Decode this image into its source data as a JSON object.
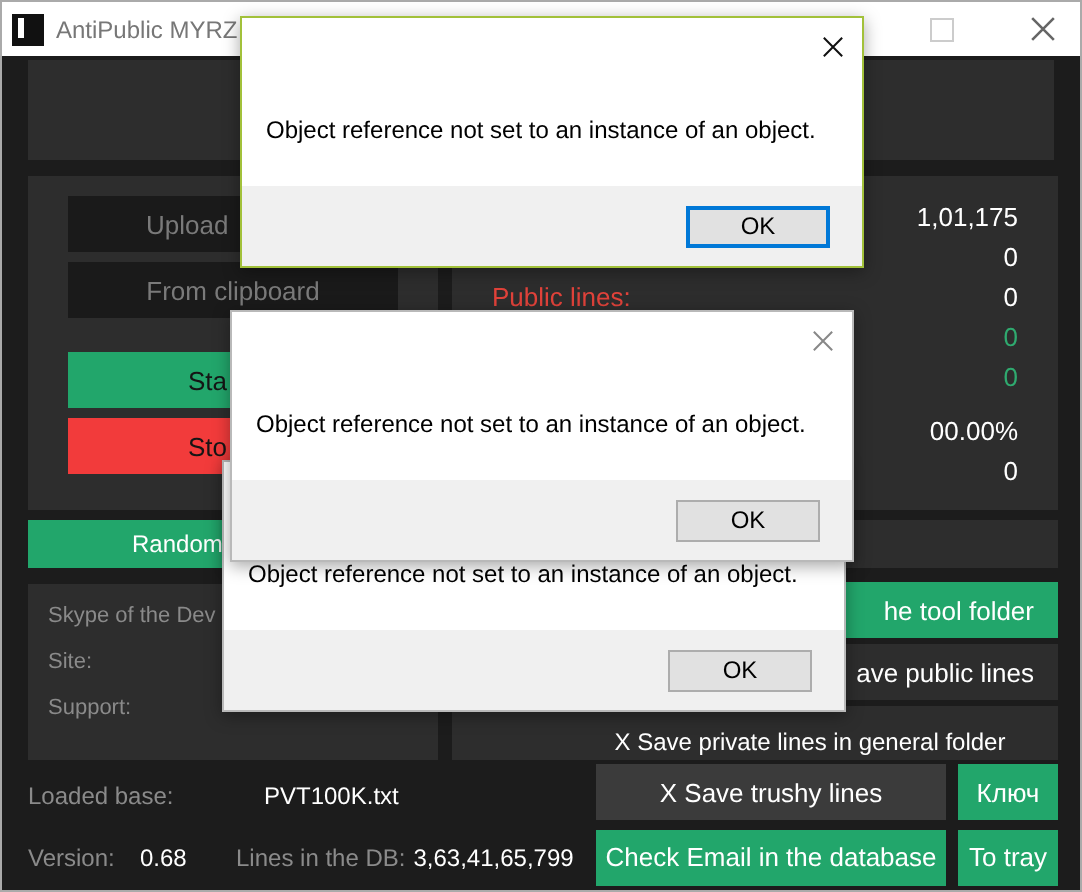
{
  "window": {
    "title": "AntiPublic MYRZ"
  },
  "left_buttons": [
    {
      "label": "Upload",
      "kind": "dark"
    },
    {
      "label": "From clipboard",
      "kind": "dark"
    },
    {
      "label": "Sta",
      "kind": "green"
    },
    {
      "label": "Sto",
      "kind": "red"
    }
  ],
  "stats": [
    {
      "value": "1,01,175",
      "color": "#ffffff"
    },
    {
      "value": "0",
      "color": "#ffffff"
    },
    {
      "label": "Public lines:",
      "value": "0",
      "color": "#ffffff"
    },
    {
      "value": "0",
      "color": "#2faa6f"
    },
    {
      "value": "0",
      "color": "#2faa6f"
    },
    {
      "value": "00.00%",
      "color": "#ffffff"
    },
    {
      "value": "0",
      "color": "#ffffff"
    }
  ],
  "random_button": {
    "label": "Random"
  },
  "info": [
    {
      "label": "Skype of the Dev"
    },
    {
      "label": "Site:"
    },
    {
      "label": "Support:"
    }
  ],
  "right_buttons": [
    {
      "label": "he tool folder",
      "kind": "green"
    },
    {
      "label": "ave public lines",
      "kind": "dark"
    },
    {
      "label": "X Save private lines in general folder",
      "kind": "dark"
    }
  ],
  "loaded_base": {
    "label": "Loaded base:",
    "value": "PVT100K.txt"
  },
  "version": {
    "label": "Version:",
    "value": "0.68"
  },
  "db_lines": {
    "label": "Lines in the DB:",
    "value": "3,63,41,65,799"
  },
  "bottom_buttons": [
    {
      "label": "X Save trushy lines",
      "kind": "dark"
    },
    {
      "label": "Ключ",
      "kind": "green"
    },
    {
      "label": "Check Email in the database",
      "kind": "green"
    },
    {
      "label": "To tray",
      "kind": "green"
    }
  ],
  "dialogs": [
    {
      "message": "Object reference not set to an instance of an object.",
      "button": "OK",
      "active": true
    },
    {
      "message": "Object reference not set to an instance of an object.",
      "button": "OK",
      "active": false
    },
    {
      "message": "Object reference not set to an instance of an object.",
      "button": "OK",
      "active": false
    }
  ]
}
